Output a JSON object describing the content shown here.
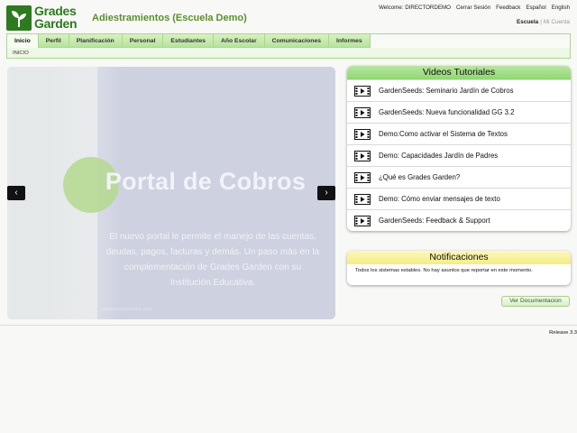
{
  "header": {
    "logo_line1": "Grades",
    "logo_line2": "Garden",
    "title": "Adiestramientos (Escuela Demo)",
    "top_links": {
      "welcome": "Welcome: DIRECTORDEMO",
      "logout": "Cerrar Sesión",
      "feedback": "Feedback",
      "spanish": "Español",
      "english": "English"
    },
    "school_link": "Escuela",
    "separator": "|",
    "account_link": "Mi Cuenta"
  },
  "nav": {
    "tabs": [
      "Inicio",
      "Perfil",
      "Planificación",
      "Personal",
      "Estudiantes",
      "Año Escolar",
      "Comunicaciones",
      "Informes"
    ],
    "active_tab": "Inicio",
    "breadcrumb": "INICIO"
  },
  "carousel": {
    "title": "Portal de Cobros",
    "body": "El nuevo portal le permite el manejo de las cuentas, deudas, pagos, facturas y demás. Un paso más en la complementación de Grades Garden con su Institución Educativa.",
    "caption": "Grades Garden Portal, 2016",
    "prev": "‹",
    "next": "›"
  },
  "videos": {
    "title": "Videos Tutoriales",
    "items": [
      "GardenSeeds: Seminario Jardín de Cobros",
      "GardenSeeds: Nueva funcionalidad GG 3.2",
      "Demo:Como activar el Sistema de Textos",
      "Demo: Capacidades Jardín de Padres",
      "¿Qué es Grades Garden?",
      "Demo: Cómo enviar mensajes de texto",
      "GardenSeeds: Feedback & Support"
    ]
  },
  "notifications": {
    "title": "Notificaciones",
    "message": "Todos los sistemas estables. No hay asuntos que reportar en este momento."
  },
  "docs_button": "Ver Documentacion",
  "release": "Release 3.3",
  "colors": {
    "brand_green": "#2d7a1f",
    "title_green": "#5a8f2f",
    "nav_green": "#b9e39c",
    "video_header": "#8fd672",
    "notif_header": "#f5ec86"
  }
}
